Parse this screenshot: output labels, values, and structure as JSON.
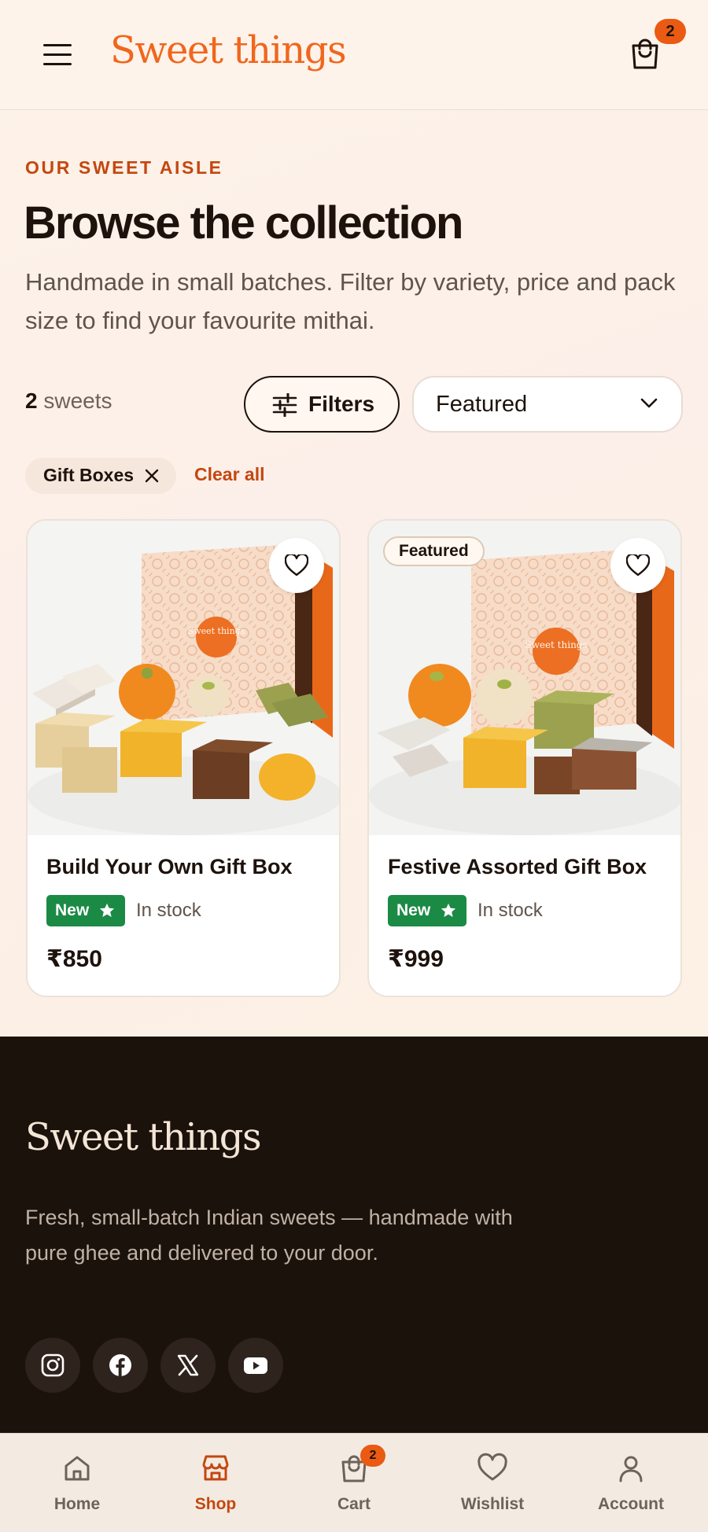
{
  "header": {
    "logo": "Sweet things",
    "cart_count": "2",
    "icons": [
      "menu-icon",
      "shopping-bag-icon"
    ]
  },
  "intro": {
    "eyebrow": "OUR SWEET AISLE",
    "title": "Browse the collection",
    "description": "Handmade in small batches. Filter by variety, price and pack size to find your favourite mithai."
  },
  "toolbar": {
    "count_number": "2",
    "count_label": "sweets",
    "filters_label": "Filters",
    "sort_value": "Featured"
  },
  "active_filters": {
    "chips": [
      {
        "label": "Gift Boxes"
      }
    ],
    "clear_label": "Clear all"
  },
  "products": [
    {
      "name": "Build Your Own Gift Box",
      "badge": "New",
      "stock": "In stock",
      "price": "₹850",
      "featured": false,
      "box_logo": "Sweet things"
    },
    {
      "name": "Festive Assorted Gift Box",
      "badge": "New",
      "stock": "In stock",
      "price": "₹999",
      "featured": true,
      "featured_label": "Featured",
      "box_logo": "Sweet things"
    }
  ],
  "footer": {
    "logo": "Sweet things",
    "description": "Fresh, small-batch Indian sweets — handmade with pure ghee and delivered to your door.",
    "social": [
      "instagram-icon",
      "facebook-icon",
      "x-icon",
      "youtube-icon"
    ]
  },
  "bottom_nav": {
    "items": [
      {
        "label": "Home",
        "icon": "home-icon"
      },
      {
        "label": "Shop",
        "icon": "shop-icon",
        "active": true
      },
      {
        "label": "Cart",
        "icon": "shopping-bag-icon",
        "badge": "2"
      },
      {
        "label": "Wishlist",
        "icon": "heart-icon"
      },
      {
        "label": "Account",
        "icon": "user-icon"
      }
    ]
  },
  "colors": {
    "brand_orange": "#f0661d",
    "accent_dark_orange": "#c4470f",
    "badge_green": "#1b8a45",
    "footer_bg": "#1c120c"
  }
}
